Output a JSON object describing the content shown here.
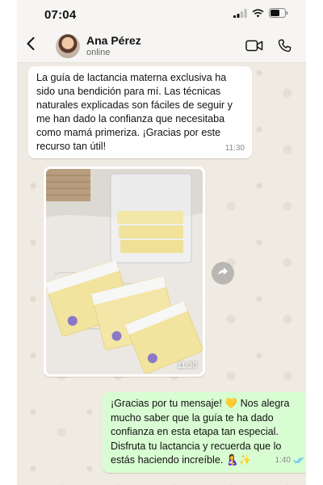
{
  "status_bar": {
    "time": "07:04"
  },
  "contact": {
    "name": "Ana Pérez",
    "status": "online"
  },
  "messages": {
    "incoming_text": {
      "text": "La guía de lactancia materna exclusiva ha sido una bendición para mí. Las técnicas naturales explicadas son fáciles de seguir y me han dado la confianza que necesitaba como mamá primeriza. ¡Gracias por este recurso tan útil!",
      "time": "11:30"
    },
    "incoming_photo": {
      "time": "11:30",
      "brand": "momcozy"
    },
    "outgoing_text": {
      "text": "¡Gracias por tu mensaje! 💛 Nos alegra mucho saber que la guía te ha dado confianza en esta etapa tan especial. Disfruta tu lactancia y recuerda que lo estás haciendo increíble. 🤱✨",
      "time": "1:40"
    }
  },
  "colors": {
    "chat_background": "#efeae2",
    "incoming_bubble": "#ffffff",
    "outgoing_bubble": "#d9fdd3",
    "read_ticks": "#53bdeb"
  },
  "icons": [
    "signal-icon",
    "wifi-icon",
    "battery-icon",
    "back-chevron-icon",
    "video-call-icon",
    "phone-call-icon",
    "forward-icon",
    "double-check-icon"
  ]
}
